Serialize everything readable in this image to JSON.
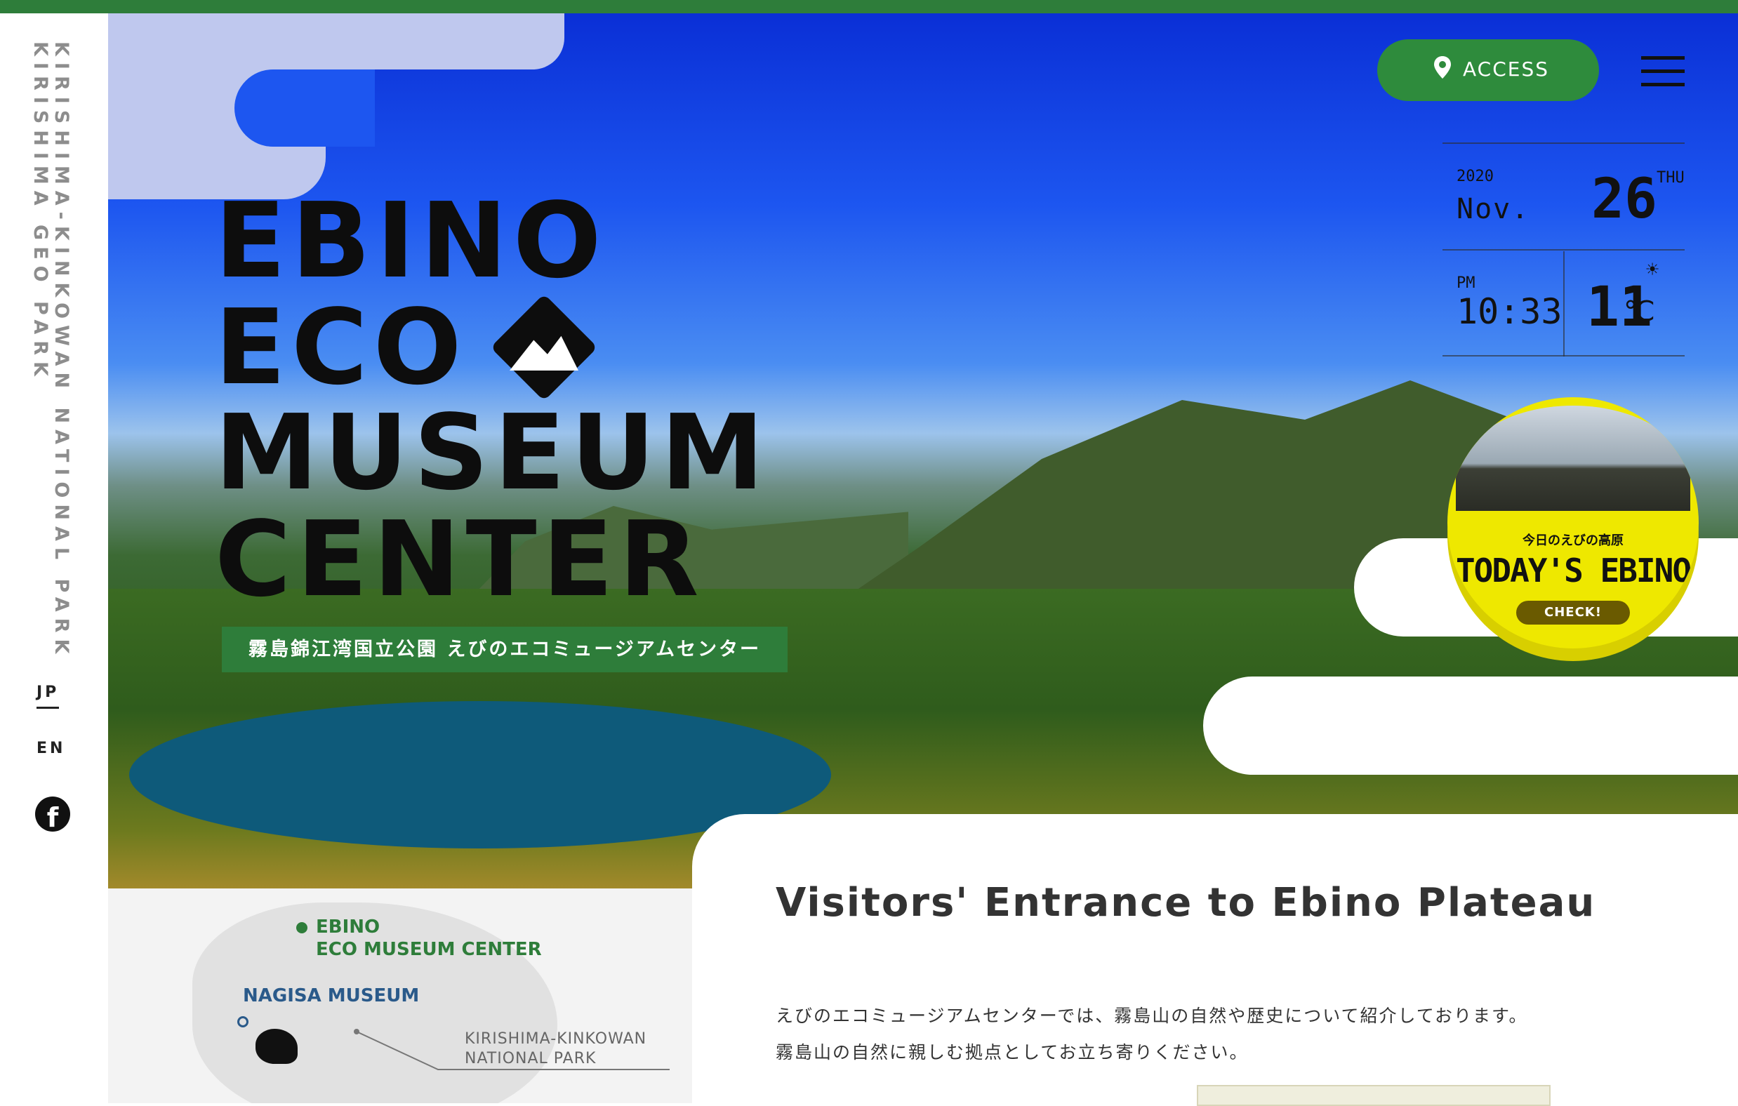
{
  "sidebar": {
    "vertical_title_1": "KIRISHIMA-KINKOWAN NATIONAL PARK",
    "vertical_title_2": "KIRISHIMA GEO PARK",
    "lang_jp": "JP",
    "lang_en": "EN",
    "social_icon": "facebook-icon"
  },
  "hero": {
    "title_line_1": "EBINO",
    "title_line_2": "ECO",
    "title_line_3": "MUSEUM",
    "title_line_4": "CENTER",
    "subtitle": "霧島錦江湾国立公園 えびのエコミュージアムセンター"
  },
  "header": {
    "access_label": "ACCESS",
    "access_icon": "location-pin-icon",
    "menu_icon": "hamburger-menu-icon"
  },
  "date_widget": {
    "year": "2020",
    "month": "Nov.",
    "day": "26",
    "weekday": "THU",
    "ampm": "PM",
    "time": "10:33",
    "temperature": "11",
    "unit": "℃",
    "weather_icon": "sun-icon"
  },
  "today_ebino": {
    "jp_label": "今日のえびの高原",
    "en_label": "TODAY'S EBINO",
    "check_label": "CHECK!"
  },
  "map": {
    "ebino_label_1": "EBINO",
    "ebino_label_2": "ECO MUSEUM CENTER",
    "nagisa_label": "NAGISA MUSEUM",
    "park_label_1": "KIRISHIMA-KINKOWAN",
    "park_label_2": "NATIONAL PARK"
  },
  "intro": {
    "heading": "Visitors' Entrance to Ebino Plateau",
    "paragraph_1": "えびのエコミュージアムセンターでは、霧島山の自然や歴史について紹介しております。",
    "paragraph_2": "霧島山の自然に親しむ拠点としてお立ち寄りください。"
  },
  "colors": {
    "brand_green": "#2e7d3a",
    "accent_yellow": "#eee800"
  }
}
